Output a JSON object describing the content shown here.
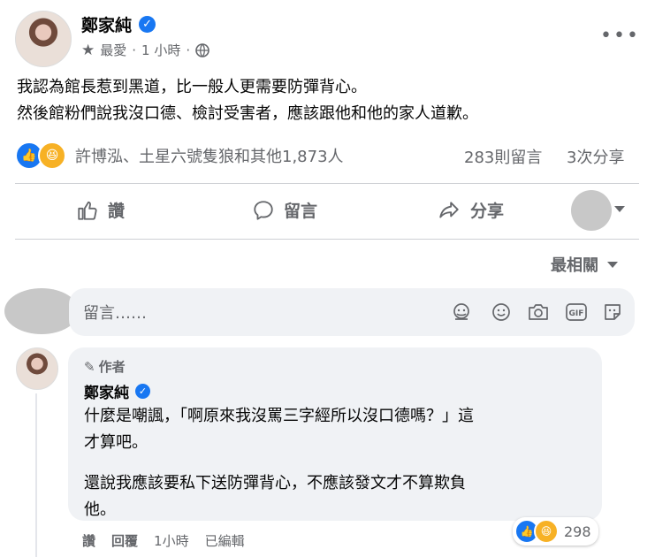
{
  "post": {
    "author": "鄭家純",
    "audience": "最愛",
    "time": "1 小時",
    "dot": "·",
    "lines": [
      "我認為館長惹到黑道，比一般人更需要防彈背心。",
      "然後館粉們說我沒口德、檢討受害者，應該跟他和他的家人道歉。"
    ]
  },
  "reactions": {
    "summary": "許博泓、土星六號隻狼和其他1,873人",
    "comments": "283則留言",
    "shares": "3次分享"
  },
  "actions": {
    "like": "讚",
    "comment": "留言",
    "share": "分享"
  },
  "sort": {
    "label": "最相關"
  },
  "composer": {
    "placeholder": "留言……"
  },
  "comment": {
    "badge": "作者",
    "author": "鄭家純",
    "para1_line1": "什麼是嘲諷，「啊原來我沒罵三字經所以沒口德嗎？」這",
    "para1_line2": "才算吧。",
    "para2_line1": "還說我應該要私下送防彈背心，不應該發文才不算欺負",
    "para2_line2": "他。",
    "like": "讚",
    "reply": "回覆",
    "time": "1小時",
    "edited": "已編輯",
    "reaction_count": "298"
  },
  "colors": {
    "accent": "#1877f2",
    "secondary_text": "#65676b",
    "bubble": "#f0f2f5"
  }
}
